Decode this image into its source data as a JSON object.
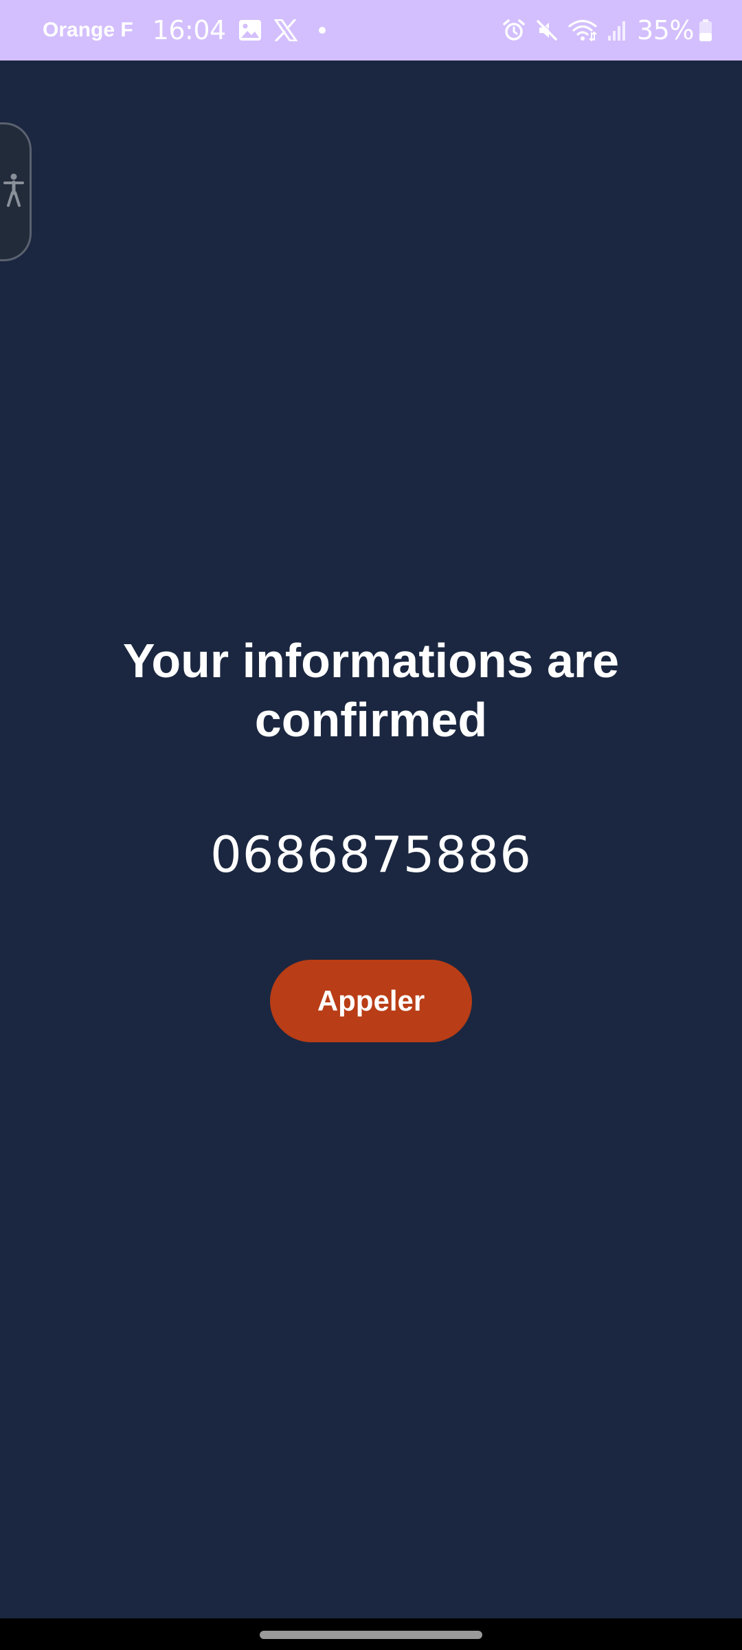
{
  "status_bar": {
    "carrier": "Orange F",
    "time": "16:04",
    "battery": "35%",
    "left_icons": [
      "image-icon",
      "x-logo-icon",
      "notification-dot-icon"
    ],
    "right_icons": [
      "alarm-icon",
      "mute-icon",
      "wifi-icon",
      "signal-icon",
      "battery-icon"
    ],
    "background": "#d3bffd"
  },
  "accessibility": {
    "icon": "accessibility-icon"
  },
  "main": {
    "title_line1": "Your informations are",
    "title_line2": "confirmed",
    "phone_number": "0686875886",
    "call_button_label": "Appeler",
    "background": "#1b2740",
    "button_color": "#b93d16"
  }
}
